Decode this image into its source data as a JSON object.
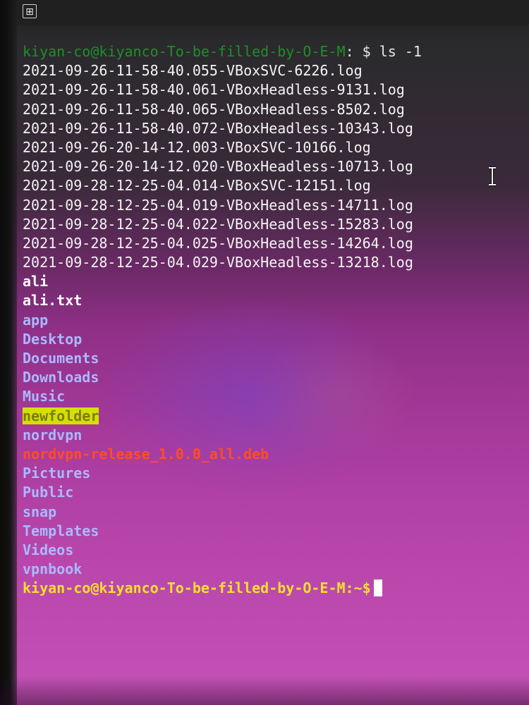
{
  "topbar": {
    "new_tab_symbol": "⊞"
  },
  "terminal": {
    "first_prompt": {
      "user_host": "kiyan-co@kiyanco-To-be-filled-by-O-E-M",
      "suffix": ": $ ls -1"
    },
    "files": [
      "2021-09-26-11-58-40.055-VBoxSVC-6226.log",
      "2021-09-26-11-58-40.061-VBoxHeadless-9131.log",
      "2021-09-26-11-58-40.065-VBoxHeadless-8502.log",
      "2021-09-26-11-58-40.072-VBoxHeadless-10343.log",
      "2021-09-26-20-14-12.003-VBoxSVC-10166.log",
      "2021-09-26-20-14-12.020-VBoxHeadless-10713.log",
      "2021-09-28-12-25-04.014-VBoxSVC-12151.log",
      "2021-09-28-12-25-04.019-VBoxHeadless-14711.log",
      "2021-09-28-12-25-04.022-VBoxHeadless-15283.log",
      "2021-09-28-12-25-04.025-VBoxHeadless-14264.log",
      "2021-09-28-12-25-04.029-VBoxHeadless-13218.log"
    ],
    "plain_files": [
      "ali",
      "ali.txt"
    ],
    "dirs_a": [
      "app",
      "Desktop",
      "Documents",
      "Downloads",
      "Music"
    ],
    "highlighted_dir": "newfolder",
    "dir_nordvpn": "nordvpn",
    "deb_file": "nordvpn-release_1.0.0_all.deb",
    "dirs_b": [
      "Pictures",
      "Public",
      "snap",
      "Templates",
      "Videos",
      "vpnbook"
    ],
    "last_prompt": "kiyan-co@kiyanco-To-be-filled-by-O-E-M:~$",
    "colors": {
      "background_top": "#2a2a2c",
      "background_bottom": "#c452b6",
      "prompt_green": "#1e8f2a",
      "prompt_yellow": "#f5e02a",
      "directory_blue": "#a9b9ff",
      "highlight_bg": "#d3e000",
      "deb_red": "#ff4d24"
    }
  },
  "pointer": {
    "icon": "text-cursor-ibeam-icon"
  }
}
